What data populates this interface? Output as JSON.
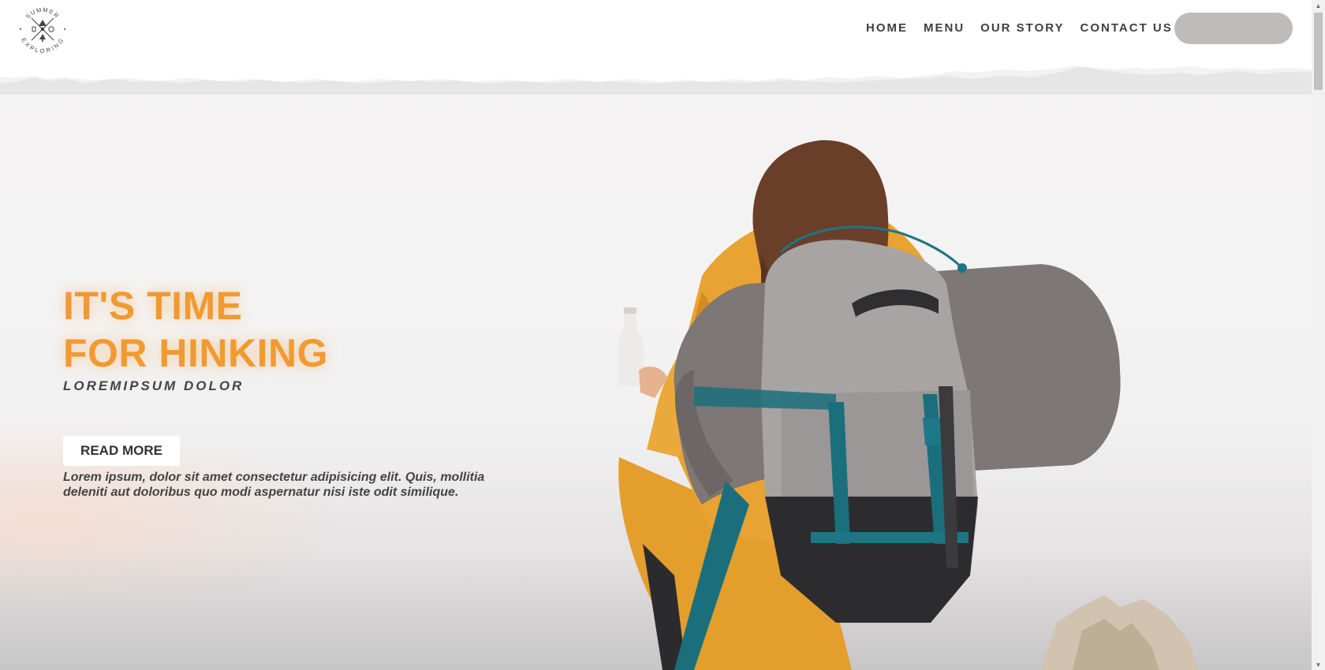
{
  "brand": {
    "logo_text_top": "SUMMER",
    "logo_text_bottom": "EXPLORING"
  },
  "nav": {
    "items": [
      "HOME",
      "MENU",
      "OUR STORY",
      "CONTACT US"
    ],
    "pill_label": ""
  },
  "hero": {
    "headline_line1": "IT'S TIME",
    "headline_line2": "FOR HINKING",
    "subhead": "LOREMIPSUM DOLOR",
    "cta_label": "READ MORE",
    "description": "Lorem ipsum, dolor sit amet consectetur adipisicing elit. Quis, mollitia deleniti aut doloribus quo modi aspernatur nisi iste odit similique."
  },
  "colors": {
    "accent": "#f29a32",
    "nav_text": "#3f3f3f",
    "pill": "#bfbbba"
  },
  "icons": {
    "logo": "summer-exploring-badge-icon",
    "scroll_up": "arrow-up-icon",
    "scroll_down": "arrow-down-icon"
  }
}
